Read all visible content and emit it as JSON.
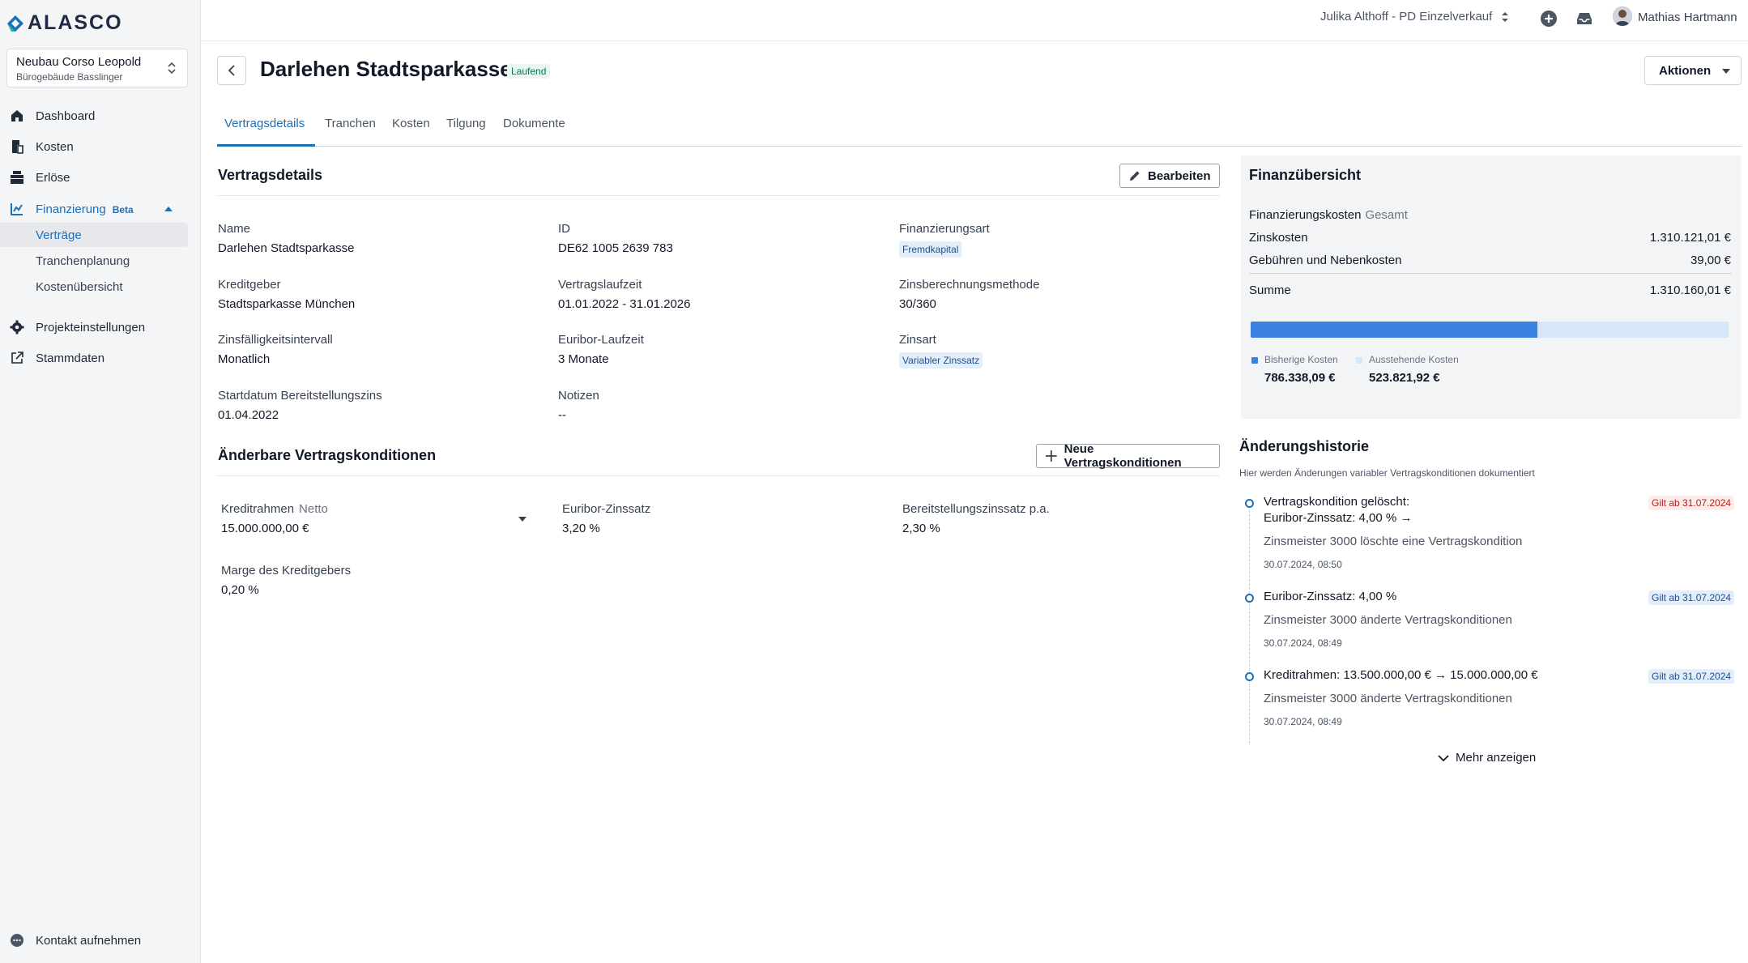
{
  "app": {
    "logo_text": "ALASCO"
  },
  "project": {
    "name": "Neubau Corso Leopold",
    "subtitle": "Bürogebäude Basslinger"
  },
  "sidebar": {
    "items": [
      {
        "label": "Dashboard",
        "icon": "home-icon"
      },
      {
        "label": "Kosten",
        "icon": "receipt-icon"
      },
      {
        "label": "Erlöse",
        "icon": "register-icon"
      },
      {
        "label": "Finanzierung",
        "badge": "Beta",
        "icon": "finance-icon"
      },
      {
        "label": "Projekteinstellungen",
        "icon": "gear-icon"
      },
      {
        "label": "Stammdaten",
        "icon": "external-link-icon"
      }
    ],
    "sub_items": [
      "Verträge",
      "Tranchenplanung",
      "Kostenübersicht"
    ],
    "contact_label": "Kontakt aufnehmen"
  },
  "topbar": {
    "user_select": "Julika Althoff - PD Einzelverkauf",
    "user_name": "Mathias Hartmann"
  },
  "header": {
    "title": "Darlehen Stadtsparkasse",
    "status": "Laufend",
    "actions_label": "Aktionen"
  },
  "tabs": [
    "Vertragsdetails",
    "Tranchen",
    "Kosten",
    "Tilgung",
    "Dokumente"
  ],
  "details": {
    "title": "Vertragsdetails",
    "edit_label": "Bearbeiten",
    "fields": [
      {
        "label": "Name",
        "value": "Darlehen Stadtsparkasse"
      },
      {
        "label": "ID",
        "value": "DE62 1005 2639 783"
      },
      {
        "label": "Finanzierungsart",
        "value": "Fremdkapital"
      },
      {
        "label": "Kreditgeber",
        "value": "Stadtsparkasse München"
      },
      {
        "label": "Vertragslaufzeit",
        "value": "01.01.2022 - 31.01.2026"
      },
      {
        "label": "Zinsberechnungsmethode",
        "value": "30/360"
      },
      {
        "label": "Zinsfälligkeitsintervall",
        "value": "Monatlich"
      },
      {
        "label": "Euribor-Laufzeit",
        "value": "3 Monate"
      },
      {
        "label": "Zinsart",
        "value": "Variabler Zinssatz"
      },
      {
        "label": "Startdatum Bereitstellungszins",
        "value": "01.04.2022"
      },
      {
        "label": "Notizen",
        "value": "--"
      }
    ]
  },
  "conditions": {
    "title": "Änderbare Vertragskonditionen",
    "new_label": "Neue Vertragskonditionen",
    "fields": [
      {
        "label": "Kreditrahmen",
        "hint": "Netto",
        "value": "15.000.000,00 €"
      },
      {
        "label": "Euribor-Zinssatz",
        "value": "3,20 %"
      },
      {
        "label": "Bereitstellungszinssatz p.a.",
        "value": "2,30 %"
      },
      {
        "label": "Marge des Kreditgebers",
        "value": "0,20 %"
      }
    ]
  },
  "finance": {
    "title": "Finanzübersicht",
    "subtitle": "Finanzierungskosten",
    "subtitle_muted": "Gesamt",
    "rows": [
      {
        "label": "Zinskosten",
        "value": "1.310.121,01 €"
      },
      {
        "label": "Gebühren und Nebenkosten",
        "value": "39,00 €"
      }
    ],
    "total": {
      "label": "Summe",
      "value": "1.310.160,01 €"
    },
    "progress_fraction": 0.6,
    "legend": [
      {
        "label": "Bisherige Kosten",
        "value": "786.338,09 €",
        "color": "#3b82e0"
      },
      {
        "label": "Ausstehende Kosten",
        "value": "523.821,92 €",
        "color": "#d6e6fb"
      }
    ]
  },
  "history": {
    "title": "Änderungshistorie",
    "subtitle": "Hier werden Änderungen variabler Vertragskonditionen dokumentiert",
    "entries": [
      {
        "head1": "Vertragskondition gelöscht:",
        "head2": "Euribor-Zinssatz: 4,00 % →",
        "desc": "Zinsmeister 3000 löschte eine Vertragskondition",
        "time": "30.07.2024, 08:50",
        "badge": "Gilt ab 31.07.2024"
      },
      {
        "head1": "Euribor-Zinssatz: 4,00 %",
        "desc": "Zinsmeister 3000 änderte Vertragskonditionen",
        "time": "30.07.2024, 08:49",
        "badge": "Gilt ab 31.07.2024"
      },
      {
        "head1": "Kreditrahmen: 13.500.000,00 € → 15.000.000,00 €",
        "desc": "Zinsmeister 3000 änderte Vertragskonditionen",
        "time": "30.07.2024, 08:49",
        "badge": "Gilt ab 31.07.2024"
      }
    ],
    "more_label": "Mehr anzeigen"
  },
  "colors": {
    "accent": "#1d6fb8",
    "bar_filled": "#3b82e0",
    "bar_remaining": "#d6e6fb"
  }
}
